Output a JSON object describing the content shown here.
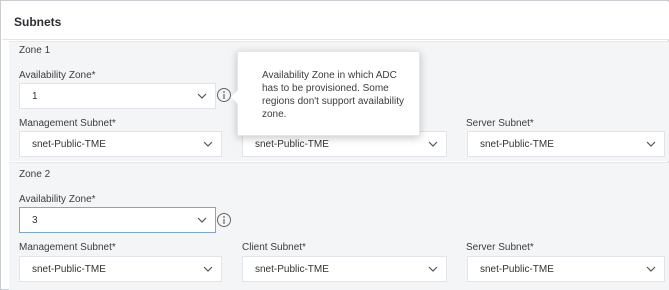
{
  "section": {
    "title": "Subnets"
  },
  "labels": {
    "availability_zone": "Availability Zone*",
    "management_subnet": "Management Subnet*",
    "client_subnet": "Client Subnet*",
    "server_subnet": "Server Subnet*"
  },
  "zones": [
    {
      "title": "Zone 1",
      "availability_zone": "1",
      "management_subnet": "snet-Public-TME",
      "client_subnet": "snet-Public-TME",
      "server_subnet": "snet-Public-TME"
    },
    {
      "title": "Zone 2",
      "availability_zone": "3",
      "management_subnet": "snet-Public-TME",
      "client_subnet": "snet-Public-TME",
      "server_subnet": "snet-Public-TME"
    }
  ],
  "tooltip": {
    "text": "Availability Zone in which ADC has to be provisioned. Some regions don't support availability zone."
  },
  "icons": {
    "chevron": "chevron-down-icon",
    "info": "info-icon"
  },
  "colors": {
    "focus_border": "#7aa7d6",
    "zone_background": "#f3f5f7"
  }
}
